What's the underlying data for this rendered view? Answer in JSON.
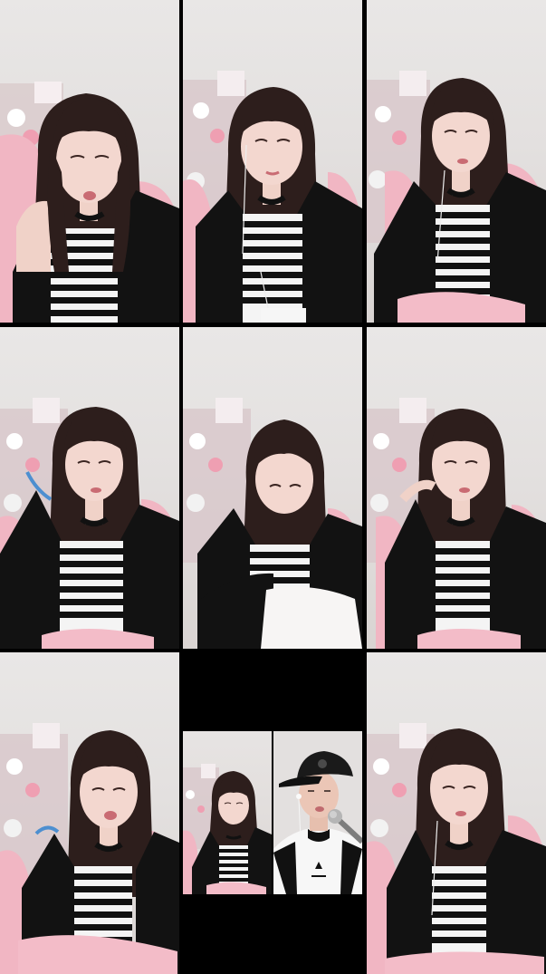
{
  "grid": {
    "rows": 3,
    "columns": 3,
    "background": "#000000",
    "tiles": [
      {
        "id": "r0c0",
        "kind": "video-frame"
      },
      {
        "id": "r0c1",
        "kind": "video-frame"
      },
      {
        "id": "r0c2",
        "kind": "video-frame"
      },
      {
        "id": "r1c0",
        "kind": "video-frame"
      },
      {
        "id": "r1c1",
        "kind": "video-frame"
      },
      {
        "id": "r1c2",
        "kind": "video-frame"
      },
      {
        "id": "r2c0",
        "kind": "video-frame"
      },
      {
        "id": "r2c1",
        "kind": "split-video-frame"
      },
      {
        "id": "r2c2",
        "kind": "video-frame"
      }
    ]
  },
  "colors": {
    "wall": "#e6e3e2",
    "hair": "#2b1d1b",
    "jacket": "#121212",
    "chair": "#f3b7c4",
    "stripe_dark": "#111111",
    "stripe_light": "#f4f4f4",
    "skin": "#f0d2c8",
    "blanket": "#f6c2cc"
  }
}
